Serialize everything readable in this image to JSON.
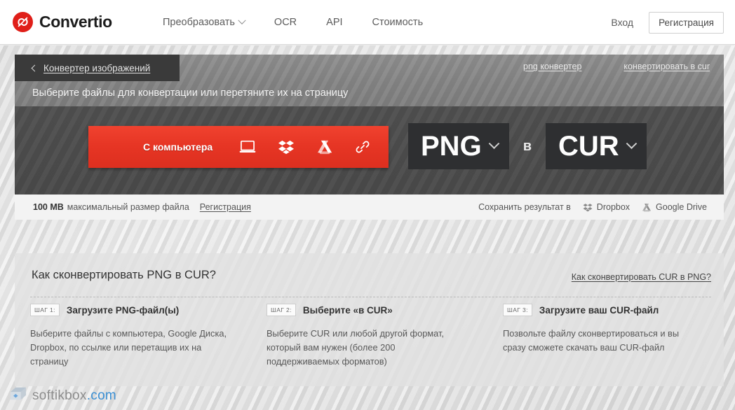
{
  "header": {
    "brand": "Convertio",
    "logo_icon": "convertio-logo-icon",
    "nav": [
      {
        "label": "Преобразовать",
        "has_dropdown": true
      },
      {
        "label": "OCR",
        "has_dropdown": false
      },
      {
        "label": "API",
        "has_dropdown": false
      },
      {
        "label": "Стоимость",
        "has_dropdown": false
      }
    ],
    "login_label": "Вход",
    "signup_label": "Регистрация"
  },
  "banner": {
    "breadcrumb_label": "Конвертер изображений",
    "back_icon": "chevron-left-icon",
    "subtitle": "Выберите файлы для конвертации или перетяните их на страницу",
    "links": [
      {
        "label": "png конвертер"
      },
      {
        "label": "конвертировать в cur"
      }
    ],
    "upload": {
      "label": "С компьютера",
      "icons": [
        {
          "name": "laptop-icon"
        },
        {
          "name": "dropbox-icon"
        },
        {
          "name": "google-drive-icon"
        },
        {
          "name": "link-icon"
        }
      ]
    },
    "format": {
      "from": "PNG",
      "separator": "в",
      "to": "CUR",
      "dropdown_icon": "chevron-down-icon"
    }
  },
  "infobar": {
    "max_size_value": "100 MB",
    "max_size_text": "максимальный размер файла",
    "register_link": "Регистрация",
    "save_to_label": "Сохранить результат в",
    "targets": [
      {
        "label": "Dropbox",
        "icon": "dropbox-icon"
      },
      {
        "label": "Google Drive",
        "icon": "google-drive-icon"
      }
    ]
  },
  "steps_section": {
    "title": "Как сконвертировать PNG в CUR?",
    "reverse_link": "Как сконвертировать CUR в PNG?",
    "steps": [
      {
        "badge": "ШАГ 1:",
        "title": "Загрузите PNG-файл(ы)",
        "desc": "Выберите файлы с компьютера, Google Диска, Dropbox, по ссылке или перетащив их на страницу"
      },
      {
        "badge": "ШАГ 2:",
        "title": "Выберите «в CUR»",
        "desc": "Выберите CUR или любой другой формат, который вам нужен (более 200 поддерживаемых форматов)"
      },
      {
        "badge": "ШАГ 3:",
        "title": "Загрузите ваш CUR-файл",
        "desc": "Позвольте файлу сконвертироваться и вы сразу сможете скачать ваш CUR-файл"
      }
    ]
  },
  "watermark": {
    "name": "softikbox",
    "tld": ".com",
    "icon": "softikbox-logo-icon"
  },
  "colors": {
    "brand_red": "#e01f19",
    "upload_red": "#e63524",
    "panel_dark": "#4c4c4c",
    "panel_strip": "#848484",
    "format_box": "#2e2f31",
    "watermark_blue": "#3a8fd4"
  }
}
